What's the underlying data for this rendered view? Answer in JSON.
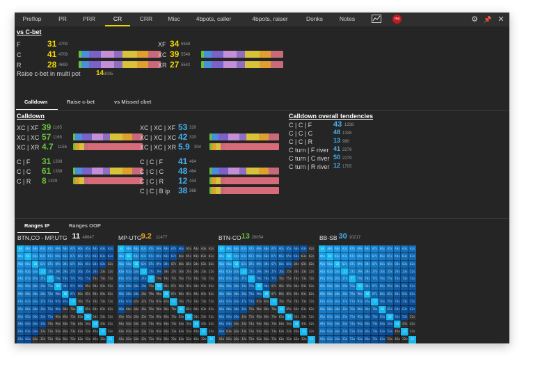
{
  "tabs": [
    "Preflop",
    "PR",
    "PRR",
    "CR",
    "CRR",
    "Misc",
    "4bpots, caller",
    "4bpots, raiser",
    "Donks",
    "Notes"
  ],
  "active_tab": "CR",
  "badge": "reg",
  "icons": [
    "chart-icon",
    "gear-icon",
    "pin-icon",
    "close-icon"
  ],
  "vs_cbet": {
    "title": "vs C-bet",
    "left": [
      {
        "label": "F",
        "value": "31",
        "count": "4709",
        "color": "y",
        "bar": false
      },
      {
        "label": "C",
        "value": "41",
        "count": "4709",
        "color": "y",
        "bar": true
      },
      {
        "label": "R",
        "value": "28",
        "count": "4699",
        "color": "y",
        "bar": true
      }
    ],
    "right": [
      {
        "label": "XF",
        "value": "34",
        "count": "5548",
        "color": "y",
        "bar": false
      },
      {
        "label": "XC",
        "value": "39",
        "count": "5548",
        "color": "y",
        "bar": true
      },
      {
        "label": "XR",
        "value": "27",
        "count": "5542",
        "color": "y",
        "bar": true
      }
    ],
    "multi_label": "Raise c-bet in multi pot",
    "multi_value": "14",
    "multi_count": "3035"
  },
  "subtabs": [
    "Calldown",
    "Raise c-bet",
    "vs Missed cbet"
  ],
  "calldown": {
    "title": "Calldown",
    "col1_a": [
      {
        "label": "XC | XF",
        "value": "39",
        "count": "1165",
        "color": "g",
        "bar": false
      },
      {
        "label": "XC | XC",
        "value": "57",
        "count": "1165",
        "color": "g",
        "bar": true
      },
      {
        "label": "XC | XR",
        "value": "4.7",
        "count": "1156",
        "color": "g",
        "bar": true
      }
    ],
    "col1_b": [
      {
        "label": "C | F",
        "value": "31",
        "count": "1338",
        "color": "g",
        "bar": false
      },
      {
        "label": "C | C",
        "value": "61",
        "count": "1338",
        "color": "g",
        "bar": true
      },
      {
        "label": "C | R",
        "value": "8",
        "count": "1329",
        "color": "g",
        "bar": true
      }
    ],
    "col2_a": [
      {
        "label": "XC | XC | XF",
        "value": "53",
        "count": "320",
        "color": "b",
        "bar": false
      },
      {
        "label": "XC | XC | XC",
        "value": "42",
        "count": "320",
        "color": "b",
        "bar": true
      },
      {
        "label": "XC | XC | XR",
        "value": "5.9",
        "count": "304",
        "color": "b",
        "bar": true
      }
    ],
    "col2_b": [
      {
        "label": "C | C | F",
        "value": "41",
        "count": "464",
        "color": "b",
        "bar": false
      },
      {
        "label": "C | C | C",
        "value": "48",
        "count": "464",
        "color": "b",
        "bar": true
      },
      {
        "label": "C | C | R",
        "value": "12",
        "count": "434",
        "color": "b",
        "bar": true
      },
      {
        "label": "C | C | B ip",
        "value": "38",
        "count": "366",
        "color": "b",
        "bar": true
      }
    ]
  },
  "tendencies": {
    "title": "Calldown overall tendencies",
    "rows": [
      {
        "label": "C | C | F",
        "value": "43",
        "count": "1338",
        "big": true
      },
      {
        "label": "C | C | C",
        "value": "48",
        "count": "1338",
        "big": false
      },
      {
        "label": "C | C | R",
        "value": "13",
        "count": "980",
        "big": false
      },
      {
        "label": "C turn | F river",
        "value": "41",
        "count": "2279",
        "big": false
      },
      {
        "label": "C turn | C river",
        "value": "50",
        "count": "2279",
        "big": false
      },
      {
        "label": "C turn | R river",
        "value": "12",
        "count": "1705",
        "big": false
      }
    ]
  },
  "range_tabs": [
    "Ranges IP",
    "Ranges OOP"
  ],
  "ranges": [
    {
      "label": "BTN,CO - MP,UTG",
      "value": "11",
      "count": "48647",
      "color": "w"
    },
    {
      "label": "MP-UTG",
      "value": "9.2",
      "count": "11477",
      "color": "o"
    },
    {
      "label": "BTN-CO",
      "value": "13",
      "count": "20054",
      "color": "g"
    },
    {
      "label": "BB-SB",
      "value": "30",
      "count": "10217",
      "color": "b"
    }
  ],
  "hand_ranks": [
    "A",
    "K",
    "Q",
    "J",
    "T",
    "9",
    "8",
    "7",
    "6",
    "5",
    "4",
    "3",
    "2"
  ],
  "colors": {
    "accent": "#f0d000",
    "green": "#67c23a",
    "blue": "#42b0f0",
    "badge": "#c41920"
  }
}
